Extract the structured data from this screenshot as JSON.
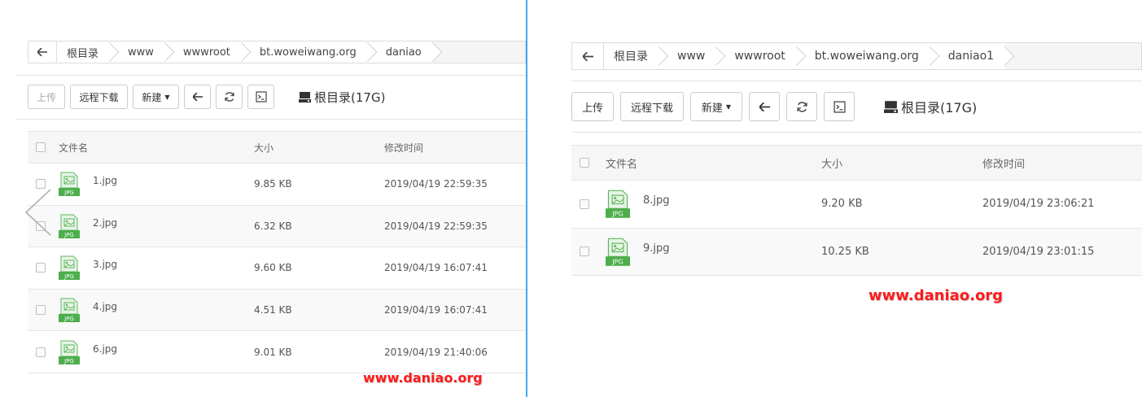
{
  "left": {
    "breadcrumb": [
      "根目录",
      "www",
      "wwwroot",
      "bt.woweiwang.org",
      "daniao"
    ],
    "toolbar": {
      "upload": "上传",
      "remote_download": "远程下载",
      "new": "新建",
      "disk": "根目录(17G)"
    },
    "table": {
      "columns": [
        "文件名",
        "大小",
        "修改时间"
      ],
      "rows": [
        {
          "name": "1.jpg",
          "size": "9.85 KB",
          "mtime": "2019/04/19 22:59:35"
        },
        {
          "name": "2.jpg",
          "size": "6.32 KB",
          "mtime": "2019/04/19 22:59:35"
        },
        {
          "name": "3.jpg",
          "size": "9.60 KB",
          "mtime": "2019/04/19 16:07:41"
        },
        {
          "name": "4.jpg",
          "size": "4.51 KB",
          "mtime": "2019/04/19 16:07:41"
        },
        {
          "name": "6.jpg",
          "size": "9.01 KB",
          "mtime": "2019/04/19 21:40:06"
        }
      ]
    },
    "watermark": "www.daniao.org"
  },
  "right": {
    "breadcrumb": [
      "根目录",
      "www",
      "wwwroot",
      "bt.woweiwang.org",
      "daniao1"
    ],
    "toolbar": {
      "upload": "上传",
      "remote_download": "远程下载",
      "new": "新建",
      "disk": "根目录(17G)"
    },
    "table": {
      "columns": [
        "文件名",
        "大小",
        "修改时间"
      ],
      "rows": [
        {
          "name": "8.jpg",
          "size": "9.20 KB",
          "mtime": "2019/04/19 23:06:21"
        },
        {
          "name": "9.jpg",
          "size": "10.25 KB",
          "mtime": "2019/04/19 23:01:15"
        }
      ]
    },
    "watermark": "www.daniao.org"
  },
  "file_icon_label": "JPG",
  "icons": {
    "back": "arrow-left-icon",
    "refresh": "refresh-icon",
    "terminal": "terminal-icon",
    "disk": "hard-drive-icon",
    "file": "jpg-file-icon",
    "carousel": "chevron-left-icon"
  },
  "colors": {
    "divider": "#3fa9f5",
    "icon_green": "#4cae4c",
    "watermark": "#ff1a1a"
  }
}
